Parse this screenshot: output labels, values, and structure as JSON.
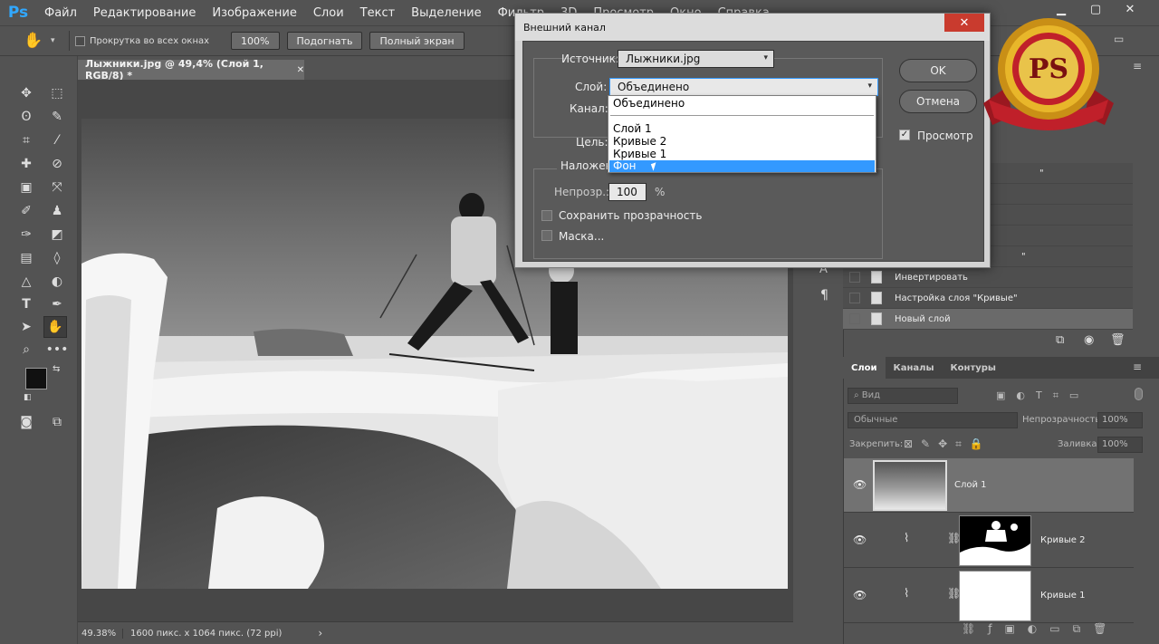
{
  "app": {
    "logo": "Ps"
  },
  "menu": [
    "Файл",
    "Редактирование",
    "Изображение",
    "Слои",
    "Текст",
    "Выделение",
    "Фильтр",
    "3D",
    "Просмотр",
    "Окно",
    "Справка"
  ],
  "options": {
    "scroll_all": "Прокрутка во всех окнах",
    "zoom_100": "100%",
    "fit": "Подогнать",
    "fullscreen": "Полный экран"
  },
  "document": {
    "tab_title": "Лыжники.jpg @ 49,4% (Слой 1, RGB/8) *",
    "zoom": "49.38%",
    "info": "1600 пикс. x 1064 пикс. (72 ppi)"
  },
  "dialog": {
    "title": "Внешний канал",
    "source_label": "Источник:",
    "source_value": "Лыжники.jpg",
    "layer_label": "Слой:",
    "layer_value": "Объединено",
    "channel_label": "Канал:",
    "target_label": "Цель:",
    "blending_label": "Наложен",
    "opacity_label": "Непрозр.:",
    "opacity_value": "100",
    "opacity_unit": "%",
    "preserve_label": "Сохранить прозрачность",
    "mask_label": "Маска...",
    "ok": "OK",
    "cancel": "Отмена",
    "preview": "Просмотр",
    "dropdown_items": [
      "Объединено",
      "Слой 1",
      "Кривые 2",
      "Кривые 1",
      "Фон"
    ],
    "dropdown_selected": "Фон"
  },
  "history": [
    {
      "label": "\""
    },
    {
      "label": "\""
    },
    {
      "label": "Инвертировать"
    },
    {
      "label": "Настройка слоя \"Кривые\""
    },
    {
      "label": "Новый слой"
    }
  ],
  "layers_panel": {
    "tabs": [
      "Слои",
      "Каналы",
      "Контуры"
    ],
    "filter": "Вид",
    "blend_mode": "Обычные",
    "opacity_label": "Непрозрачность:",
    "opacity_value": "100%",
    "lock_label": "Закрепить:",
    "fill_label": "Заливка:",
    "fill_value": "100%",
    "layers": [
      {
        "name": "Слой 1"
      },
      {
        "name": "Кривые 2"
      },
      {
        "name": "Кривые 1"
      }
    ]
  },
  "badge": {
    "text": "PS"
  },
  "colors": {
    "accent": "#3399ff",
    "badge_red": "#c0202a",
    "badge_gold": "#e8b62a"
  }
}
